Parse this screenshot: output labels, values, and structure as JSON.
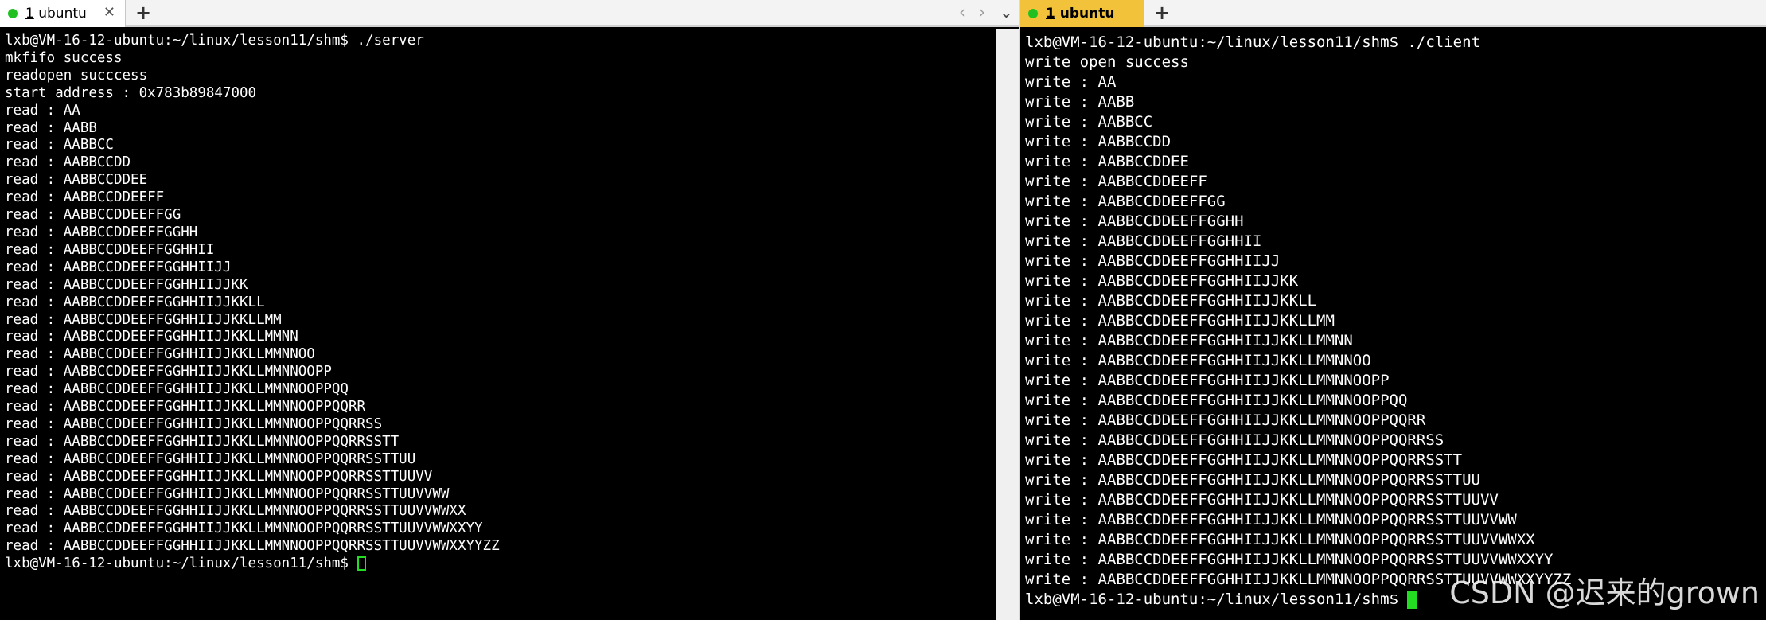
{
  "left": {
    "tab": {
      "number": "1",
      "title": "ubuntu",
      "close": "✕"
    },
    "new_tab": "+",
    "nav": {
      "prev": "‹",
      "next": "›",
      "menu": "⌄"
    },
    "lines": [
      "lxb@VM-16-12-ubuntu:~/linux/lesson11/shm$ ./server",
      "mkfifo success",
      "readopen succcess",
      "start address : 0x783b89847000",
      "read : AA",
      "read : AABB",
      "read : AABBCC",
      "read : AABBCCDD",
      "read : AABBCCDDEE",
      "read : AABBCCDDEEFF",
      "read : AABBCCDDEEFFGG",
      "read : AABBCCDDEEFFGGHH",
      "read : AABBCCDDEEFFGGHHII",
      "read : AABBCCDDEEFFGGHHIIJJ",
      "read : AABBCCDDEEFFGGHHIIJJKK",
      "read : AABBCCDDEEFFGGHHIIJJKKLL",
      "read : AABBCCDDEEFFGGHHIIJJKKLLMM",
      "read : AABBCCDDEEFFGGHHIIJJKKLLMMNN",
      "read : AABBCCDDEEFFGGHHIIJJKKLLMMNNOO",
      "read : AABBCCDDEEFFGGHHIIJJKKLLMMNNOOPP",
      "read : AABBCCDDEEFFGGHHIIJJKKLLMMNNOOPPQQ",
      "read : AABBCCDDEEFFGGHHIIJJKKLLMMNNOOPPQQRR",
      "read : AABBCCDDEEFFGGHHIIJJKKLLMMNNOOPPQQRRSS",
      "read : AABBCCDDEEFFGGHHIIJJKKLLMMNNOOPPQQRRSSTT",
      "read : AABBCCDDEEFFGGHHIIJJKKLLMMNNOOPPQQRRSSTTUU",
      "read : AABBCCDDEEFFGGHHIIJJKKLLMMNNOOPPQQRRSSTTUUVV",
      "read : AABBCCDDEEFFGGHHIIJJKKLLMMNNOOPPQQRRSSTTUUVVWW",
      "read : AABBCCDDEEFFGGHHIIJJKKLLMMNNOOPPQQRRSSTTUUVVWWXX",
      "read : AABBCCDDEEFFGGHHIIJJKKLLMMNNOOPPQQRRSSTTUUVVWWXXYY",
      "read : AABBCCDDEEFFGGHHIIJJKKLLMMNNOOPPQQRRSSTTUUVVWWXXYYZZ"
    ],
    "prompt": "lxb@VM-16-12-ubuntu:~/linux/lesson11/shm$ "
  },
  "right": {
    "tab": {
      "number": "1",
      "title": "ubuntu"
    },
    "new_tab": "+",
    "lines": [
      "lxb@VM-16-12-ubuntu:~/linux/lesson11/shm$ ./client",
      "write open success",
      "write : AA",
      "write : AABB",
      "write : AABBCC",
      "write : AABBCCDD",
      "write : AABBCCDDEE",
      "write : AABBCCDDEEFF",
      "write : AABBCCDDEEFFGG",
      "write : AABBCCDDEEFFGGHH",
      "write : AABBCCDDEEFFGGHHII",
      "write : AABBCCDDEEFFGGHHIIJJ",
      "write : AABBCCDDEEFFGGHHIIJJKK",
      "write : AABBCCDDEEFFGGHHIIJJKKLL",
      "write : AABBCCDDEEFFGGHHIIJJKKLLMM",
      "write : AABBCCDDEEFFGGHHIIJJKKLLMMNN",
      "write : AABBCCDDEEFFGGHHIIJJKKLLMMNNOO",
      "write : AABBCCDDEEFFGGHHIIJJKKLLMMNNOOPP",
      "write : AABBCCDDEEFFGGHHIIJJKKLLMMNNOOPPQQ",
      "write : AABBCCDDEEFFGGHHIIJJKKLLMMNNOOPPQQRR",
      "write : AABBCCDDEEFFGGHHIIJJKKLLMMNNOOPPQQRRSS",
      "write : AABBCCDDEEFFGGHHIIJJKKLLMMNNOOPPQQRRSSTT",
      "write : AABBCCDDEEFFGGHHIIJJKKLLMMNNOOPPQQRRSSTTUU",
      "write : AABBCCDDEEFFGGHHIIJJKKLLMMNNOOPPQQRRSSTTUUVV",
      "write : AABBCCDDEEFFGGHHIIJJKKLLMMNNOOPPQQRRSSTTUUVVWW",
      "write : AABBCCDDEEFFGGHHIIJJKKLLMMNNOOPPQQRRSSTTUUVVWWXX",
      "write : AABBCCDDEEFFGGHHIIJJKKLLMMNNOOPPQQRRSSTTUUVVWWXXYY",
      "write : AABBCCDDEEFFGGHHIIJJKKLLMMNNOOPPQQRRSSTTUUVVWWXXYYZZ"
    ],
    "prompt": "lxb@VM-16-12-ubuntu:~/linux/lesson11/shm$ "
  },
  "watermark": "CSDN @迟来的grown",
  "colors": {
    "terminal_bg": "#000000",
    "terminal_fg": "#ffffff",
    "cursor": "#22dd22",
    "active_tab": "#f2c23a",
    "status_dot": "#20c020"
  }
}
